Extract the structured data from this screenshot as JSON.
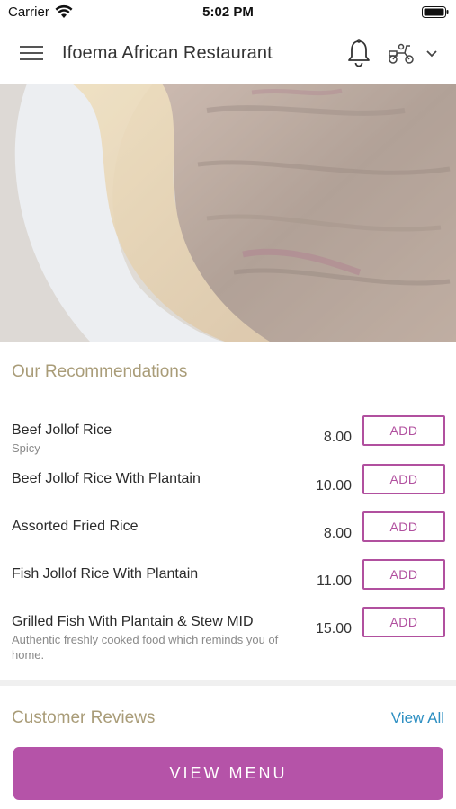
{
  "status_bar": {
    "carrier": "Carrier",
    "time": "5:02 PM"
  },
  "header": {
    "title": "Ifoema African Restaurant",
    "icons": [
      "menu-icon",
      "bell-icon",
      "scooter-icon",
      "chevron-down-icon"
    ]
  },
  "recommendations": {
    "title": "Our Recommendations",
    "add_label": "ADD",
    "items": [
      {
        "name": "Beef Jollof Rice",
        "description": "Spicy",
        "price": "8.00"
      },
      {
        "name": "Beef Jollof Rice With Plantain",
        "description": "",
        "price": "10.00"
      },
      {
        "name": "Assorted Fried Rice",
        "description": "",
        "price": "8.00"
      },
      {
        "name": "Fish Jollof Rice With Plantain",
        "description": "",
        "price": "11.00"
      },
      {
        "name": "Grilled Fish With Plantain & Stew MID",
        "description": "Authentic freshly cooked food which reminds you of home.",
        "price": "15.00"
      }
    ]
  },
  "reviews": {
    "title": "Customer Reviews",
    "view_all": "View All"
  },
  "cta": {
    "label": "VIEW MENU"
  },
  "colors": {
    "accent": "#b553a8",
    "section_title": "#a99c78",
    "link": "#2d8fc2"
  }
}
